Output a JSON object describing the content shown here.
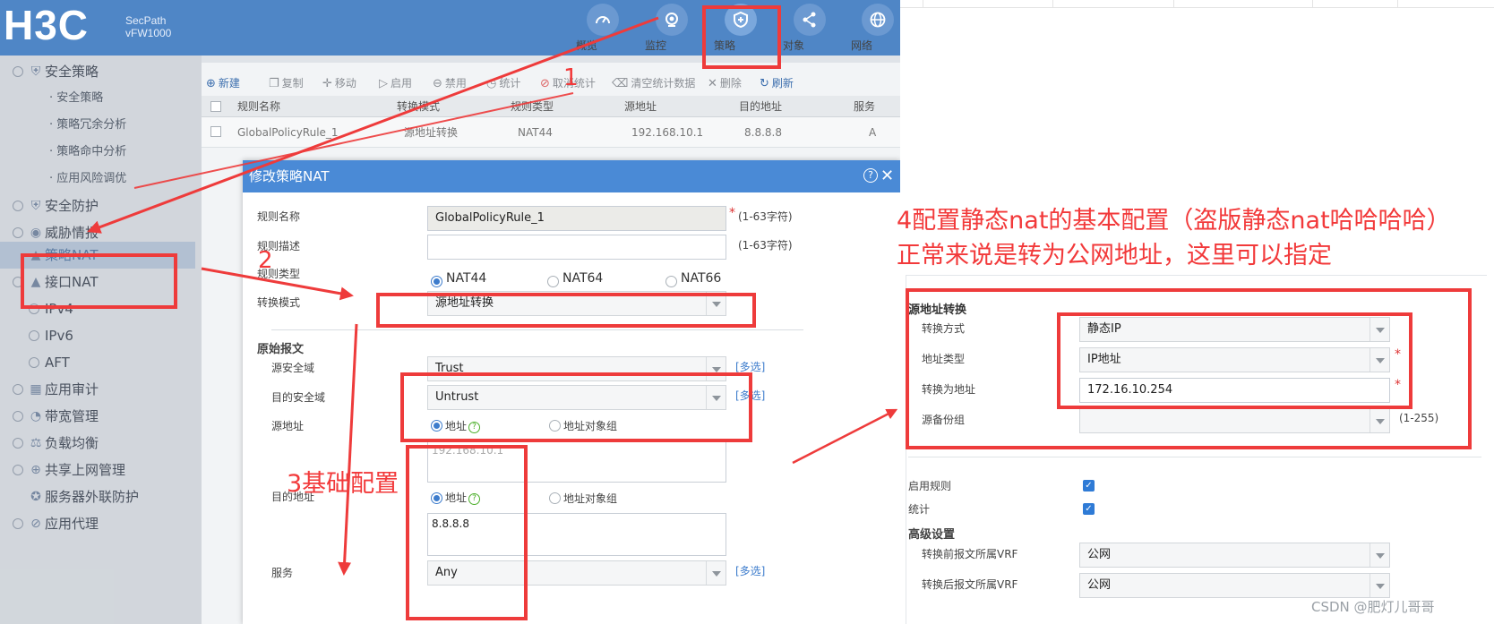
{
  "brand": {
    "logo": "H3C",
    "product_line1": "SecPath",
    "product_line2": "vFW1000"
  },
  "top_nav": [
    {
      "label": "概览",
      "icon": "dashboard-icon"
    },
    {
      "label": "监控",
      "icon": "camera-icon"
    },
    {
      "label": "策略",
      "icon": "shield-plus-icon"
    },
    {
      "label": "对象",
      "icon": "share-icon"
    },
    {
      "label": "网络",
      "icon": "globe-icon"
    }
  ],
  "sidebar": {
    "items": [
      {
        "label": "安全策略",
        "type": "group"
      },
      {
        "label": "安全策略",
        "type": "sub"
      },
      {
        "label": "策略冗余分析",
        "type": "sub"
      },
      {
        "label": "策略命中分析",
        "type": "sub"
      },
      {
        "label": "应用风险调优",
        "type": "sub"
      },
      {
        "label": "安全防护",
        "type": "group"
      },
      {
        "label": "威胁情报",
        "type": "group"
      },
      {
        "label": "策略NAT",
        "type": "active"
      },
      {
        "label": "接口NAT",
        "type": "group"
      },
      {
        "label": "IPv4",
        "type": "group"
      },
      {
        "label": "IPv6",
        "type": "group"
      },
      {
        "label": "AFT",
        "type": "group"
      },
      {
        "label": "应用审计",
        "type": "group"
      },
      {
        "label": "带宽管理",
        "type": "group"
      },
      {
        "label": "负载均衡",
        "type": "group"
      },
      {
        "label": "共享上网管理",
        "type": "group"
      },
      {
        "label": "服务器外联防护",
        "type": "group"
      },
      {
        "label": "应用代理",
        "type": "group"
      }
    ]
  },
  "toolbar": {
    "new": "新建",
    "copy": "复制",
    "move": "移动",
    "enable": "启用",
    "disable": "禁用",
    "stats": "统计",
    "cancel_stats": "取消统计",
    "clear_stats": "清空统计数据",
    "delete": "删除",
    "refresh": "刷新"
  },
  "table": {
    "columns": [
      "规则名称",
      "转换模式",
      "规则类型",
      "源地址",
      "目的地址",
      "服务"
    ],
    "rows": [
      [
        "GlobalPolicyRule_1",
        "源地址转换",
        "NAT44",
        "192.168.10.1",
        "8.8.8.8",
        "A"
      ]
    ]
  },
  "dialog": {
    "title": "修改策略NAT",
    "rule_name_label": "规则名称",
    "rule_name_value": "GlobalPolicyRule_1",
    "rule_name_hint": "(1-63字符)",
    "rule_desc_label": "规则描述",
    "rule_desc_hint": "(1-63字符)",
    "rule_type_label": "规则类型",
    "rule_type_options": [
      "NAT44",
      "NAT64",
      "NAT66"
    ],
    "trans_mode_label": "转换模式",
    "trans_mode_value": "源地址转换",
    "orig_packet_label": "原始报文",
    "src_zone_label": "源安全域",
    "src_zone_value": "Trust",
    "dst_zone_label": "目的安全域",
    "dst_zone_value": "Untrust",
    "multi_select": "[多选]",
    "src_addr_label": "源地址",
    "src_addr_opt1": "地址",
    "src_addr_opt2": "地址对象组",
    "src_addr_value": "192.168.10.1",
    "dst_addr_label": "目的地址",
    "dst_addr_opt1": "地址",
    "dst_addr_opt2": "地址对象组",
    "dst_addr_value": "8.8.8.8",
    "service_label": "服务",
    "service_value": "Any"
  },
  "right_panel": {
    "section_title": "源地址转换",
    "trans_method_label": "转换方式",
    "trans_method_value": "静态IP",
    "addr_type_label": "地址类型",
    "addr_type_value": "IP地址",
    "trans_to_label": "转换为地址",
    "trans_to_value": "172.16.10.254",
    "backup_group_label": "源备份组",
    "backup_group_hint": "(1-255)",
    "enable_rule_label": "启用规则",
    "stats_label": "统计",
    "advanced_label": "高级设置",
    "vrf_before_label": "转换前报文所属VRF",
    "vrf_before_value": "公网",
    "vrf_after_label": "转换后报文所属VRF",
    "vrf_after_value": "公网"
  },
  "annotations": {
    "a1": "1",
    "a2": "2",
    "a3": "3基础配置",
    "a4_line1": "4配置静态nat的基本配置（盗版静态nat哈哈哈哈）",
    "a4_line2": "正常来说是转为公网地址，这里可以指定"
  },
  "watermark": "CSDN @肥灯儿哥哥",
  "colors": {
    "header_blue": "#4f86c6",
    "dialog_blue": "#4a8ad6",
    "annotation_red": "#ee3b3b",
    "link_blue": "#3d7ccc"
  }
}
